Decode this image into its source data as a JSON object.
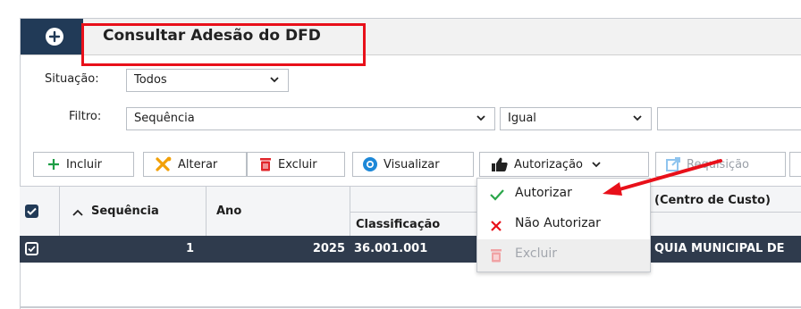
{
  "window": {
    "title": "Consultar Adesão do DFD"
  },
  "filters": {
    "situacao_label": "Situação:",
    "situacao_value": "Todos",
    "filtro_label": "Filtro:",
    "filtro_field": "Sequência",
    "filtro_operator": "Igual",
    "filtro_value": ""
  },
  "toolbar": {
    "incluir": "Incluir",
    "alterar": "Alterar",
    "excluir": "Excluir",
    "visualizar": "Visualizar",
    "autorizacao": "Autorização",
    "requisicao": "Requisição"
  },
  "grid": {
    "columns": {
      "sequencia": "Sequência",
      "ano": "Ano",
      "classificacao": "Classificação",
      "centro_custo": "(Centro de Custo)"
    },
    "rows": [
      {
        "sequencia": "1",
        "ano": "2025",
        "classificacao": "36.001.001",
        "centro_custo": "QUIA MUNICIPAL DE"
      }
    ]
  },
  "menu": {
    "items": [
      {
        "label": "Autorizar",
        "enabled": true
      },
      {
        "label": "Não Autorizar",
        "enabled": true
      },
      {
        "label": "Excluir",
        "enabled": false
      }
    ]
  },
  "colors": {
    "header_dark": "#213a57",
    "highlight_red": "#e8101a",
    "selected_row": "#2f3b4d",
    "accent_blue": "#1d88d8"
  }
}
